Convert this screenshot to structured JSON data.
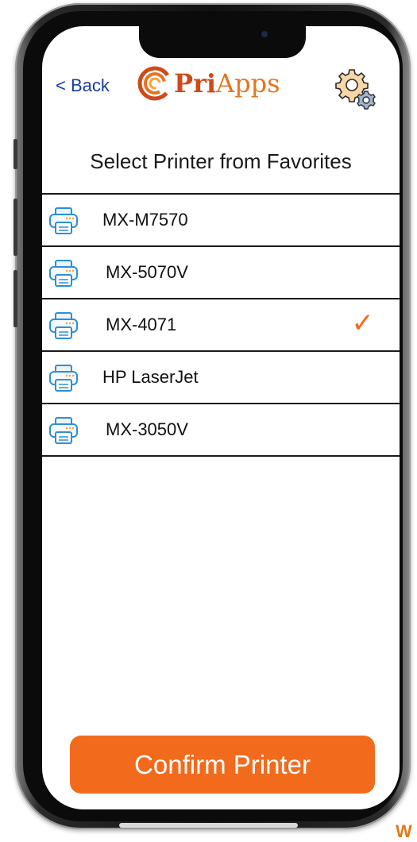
{
  "header": {
    "back_label": "< Back",
    "logo_text_part1": "Pri",
    "logo_text_part2": "Apps",
    "settings_icon": "gear-cog-icon"
  },
  "page": {
    "title": "Select Printer from Favorites"
  },
  "printers": [
    {
      "name": "MX-M7570",
      "selected": false
    },
    {
      "name": "MX-5070V",
      "selected": false
    },
    {
      "name": "MX-4071",
      "selected": true
    },
    {
      "name": "HP LaserJet",
      "selected": false
    },
    {
      "name": "MX-3050V",
      "selected": false
    }
  ],
  "check_glyph": "✓",
  "footer": {
    "confirm_label": "Confirm Printer"
  },
  "corner_text": "W",
  "colors": {
    "accent": "#f26b1d",
    "link": "#1a3c9c",
    "printer_icon": "#2d8fd5"
  }
}
